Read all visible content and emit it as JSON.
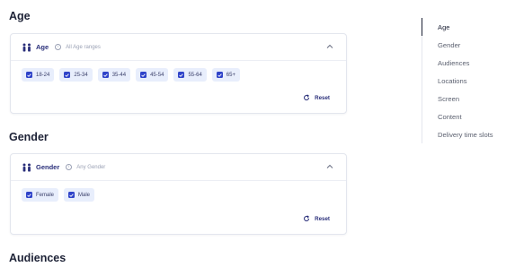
{
  "sections": {
    "age": {
      "heading": "Age",
      "card_title": "Age",
      "card_subtitle": "All Age ranges",
      "chips": [
        "18-24",
        "25-34",
        "35-44",
        "45-54",
        "55-64",
        "65+"
      ],
      "reset_label": "Reset"
    },
    "gender": {
      "heading": "Gender",
      "card_title": "Gender",
      "card_subtitle": "Any Gender",
      "chips": [
        "Female",
        "Male"
      ],
      "reset_label": "Reset"
    },
    "audiences": {
      "heading": "Audiences"
    }
  },
  "nav": {
    "items": [
      "Age",
      "Gender",
      "Audiences",
      "Locations",
      "Screen",
      "Content",
      "Delivery time slots"
    ],
    "active": "Age"
  },
  "colors": {
    "accent": "#2f43c9",
    "chip_bg": "#e8eefc",
    "title": "#2a2f7a"
  }
}
